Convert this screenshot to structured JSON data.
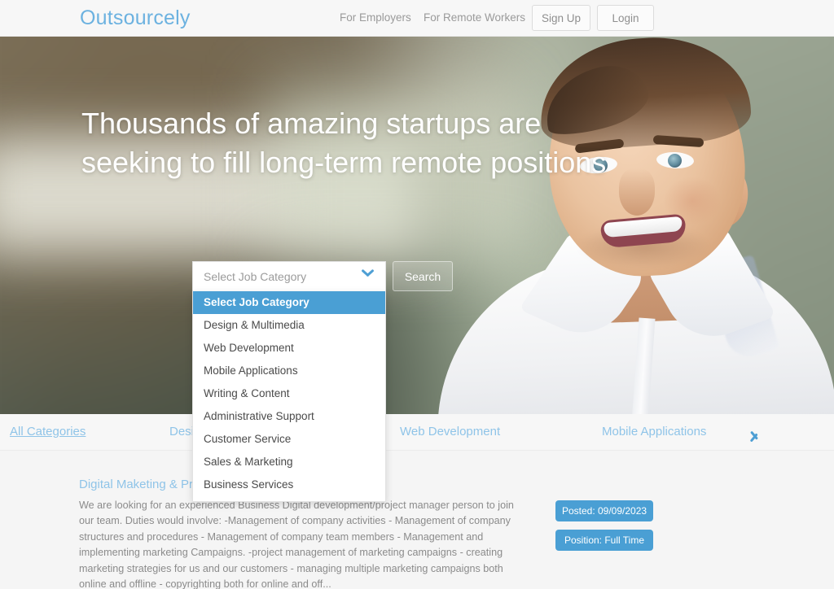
{
  "header": {
    "logo": "Outsourcely",
    "nav": [
      {
        "label": "For Employers"
      },
      {
        "label": "For Remote Workers"
      }
    ],
    "sign_up": "Sign Up",
    "login": "Login"
  },
  "hero": {
    "title": "Thousands of amazing startups are seeking to fill long-term remote positions",
    "background_description": "Smiling man in white dress shirt against blurred green bokeh background"
  },
  "search": {
    "select_value": "Select Job Category",
    "search_button": "Search",
    "dropdown_open": true,
    "options": [
      {
        "label": "Select Job Category",
        "selected": true
      },
      {
        "label": "Design & Multimedia",
        "selected": false
      },
      {
        "label": "Web Development",
        "selected": false
      },
      {
        "label": "Mobile Applications",
        "selected": false
      },
      {
        "label": "Writing & Content",
        "selected": false
      },
      {
        "label": "Administrative Support",
        "selected": false
      },
      {
        "label": "Customer Service",
        "selected": false
      },
      {
        "label": "Sales & Marketing",
        "selected": false
      },
      {
        "label": "Business Services",
        "selected": false
      }
    ]
  },
  "category_bar": {
    "items": [
      {
        "label": "All Categories",
        "active": true
      },
      {
        "label": "Design & Multimedia",
        "active": false
      },
      {
        "label": "Web Development",
        "active": false
      },
      {
        "label": "Mobile Applications",
        "active": false
      }
    ],
    "next_icon": "chevron-right-icon"
  },
  "listing": {
    "title": "Digital Maketing & Proj",
    "description": "We are looking for an experienced Business Digital development/project manager person to join our team. Duties would involve: -Management of company activities - Management of company structures and procedures - Management of company team members - Management and implementing marketing Campaigns. -project management of marketing campaigns - creating marketing strategies for us and our customers - managing multiple marketing campaigns both online and offline - copyrighting both for online and off...",
    "posted_badge": "Posted: 09/09/2023",
    "position_badge": "Position: Full Time"
  },
  "colors": {
    "accent_blue": "#4a9fd4",
    "link_blue": "#8fc4e8",
    "logo_blue": "#6cb2e0",
    "header_bg": "#f7f7f7",
    "page_bg": "#f5f5f5"
  }
}
